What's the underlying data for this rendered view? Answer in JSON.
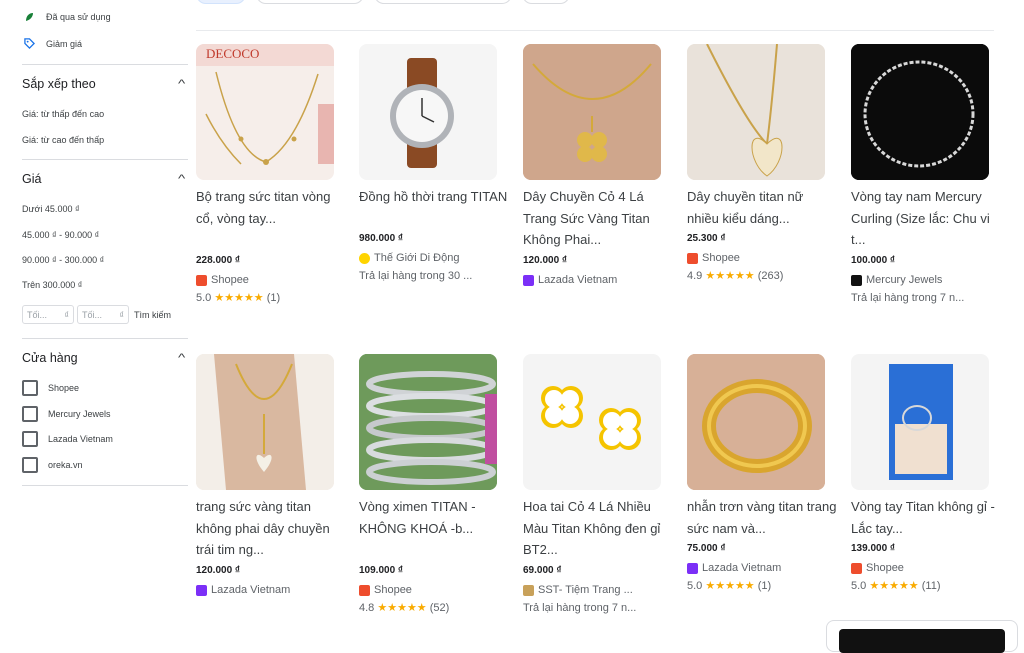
{
  "sidebar": {
    "filters_top": [
      {
        "label": "Đã qua sử dụng",
        "icon": "used-leaf-icon"
      },
      {
        "label": "Giảm giá",
        "icon": "tag-icon"
      }
    ],
    "sort": {
      "heading": "Sắp xếp theo",
      "options": [
        "Giá: từ thấp đến cao",
        "Giá: từ cao đến thấp"
      ]
    },
    "price": {
      "heading": "Giá",
      "options": [
        "Dưới 45.000 ₫",
        "45.000 ₫ - 90.000 ₫",
        "90.000 ₫ - 300.000 ₫",
        "Trên 300.000 ₫"
      ],
      "min_placeholder": "Tối...",
      "max_placeholder": "Tối...",
      "currency": "₫",
      "search_label": "Tìm kiếm"
    },
    "stores": {
      "heading": "Cửa hàng",
      "items": [
        "Shopee",
        "Mercury Jewels",
        "Lazada Vietnam",
        "oreka.vn"
      ]
    }
  },
  "products": [
    {
      "title": "Bộ trang sức titan vòng cổ, vòng tay...",
      "price": "228.000 ₫",
      "store": "Shopee",
      "store_color": "#ee4d2d",
      "rating": "5.0",
      "reviews": "(1)",
      "returns": "",
      "image_brand": "DECOCO"
    },
    {
      "title": "Đồng hồ thời trang TITAN",
      "price": "980.000 ₫",
      "store": "Thế Giới Di Động",
      "store_color": "#ffd400",
      "rating": "",
      "reviews": "",
      "returns": "Trả lại hàng trong 30 ..."
    },
    {
      "title": "Dây Chuyền Cỏ 4 Lá Trang Sức Vàng Titan Không Phai...",
      "price": "120.000 ₫",
      "store": "Lazada Vietnam",
      "store_color": "#7b2ff7",
      "rating": "",
      "reviews": "",
      "returns": ""
    },
    {
      "title": "Dây chuyền titan nữ nhiều kiểu dáng...",
      "price": "25.300 ₫",
      "store": "Shopee",
      "store_color": "#ee4d2d",
      "rating": "4.9",
      "reviews": "(263)",
      "returns": ""
    },
    {
      "title": "Vòng tay nam Mercury Curling (Size lắc: Chu vi t...",
      "price": "100.000 ₫",
      "store": "Mercury Jewels",
      "store_color": "#111111",
      "rating": "",
      "reviews": "",
      "returns": "Trả lại hàng trong 7 n..."
    },
    {
      "title": "trang sức vàng titan không phai dây chuyền trái tim ng...",
      "price": "120.000 ₫",
      "store": "Lazada Vietnam",
      "store_color": "#7b2ff7",
      "rating": "",
      "reviews": "",
      "returns": ""
    },
    {
      "title": "Vòng ximen TITAN - KHÔNG KHOÁ -b...",
      "price": "109.000 ₫",
      "store": "Shopee",
      "store_color": "#ee4d2d",
      "rating": "4.8",
      "reviews": "(52)",
      "returns": ""
    },
    {
      "title": "Hoa tai Cỏ 4 Lá Nhiều Màu Titan Không đen gỉ BT2...",
      "price": "69.000 ₫",
      "store": "SST- Tiệm Trang ...",
      "store_color": "#c8a15a",
      "rating": "",
      "reviews": "",
      "returns": "Trả lại hàng trong 7 n..."
    },
    {
      "title": "nhẫn trơn vàng titan trang sức nam và...",
      "price": "75.000 ₫",
      "store": "Lazada Vietnam",
      "store_color": "#7b2ff7",
      "rating": "5.0",
      "reviews": "(1)",
      "returns": ""
    },
    {
      "title": "Vòng tay Titan không gỉ - Lắc tay...",
      "price": "139.000 ₫",
      "store": "Shopee",
      "store_color": "#ee4d2d",
      "rating": "5.0",
      "reviews": "(11)",
      "returns": ""
    }
  ],
  "stars_text": "★★★★★",
  "colors": {
    "star": "#f9ab00",
    "shopee": "#ee4d2d",
    "lazada": "#7b2ff7"
  }
}
